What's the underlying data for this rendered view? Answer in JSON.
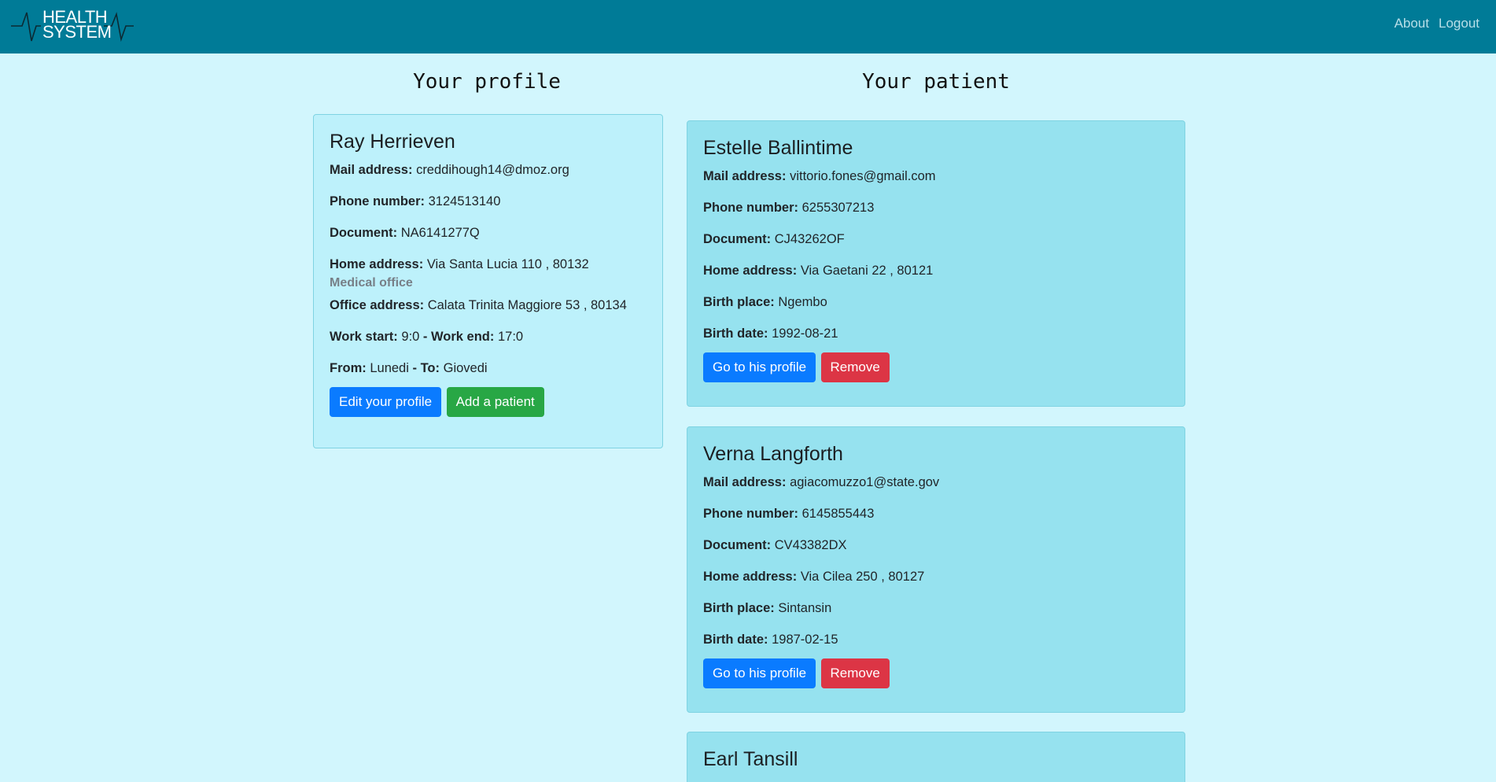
{
  "navbar": {
    "logo_line1": "HEALTH",
    "logo_line2": "SYSTEM",
    "about": "About",
    "logout": "Logout"
  },
  "profile": {
    "section_title": "Your profile",
    "name": "Ray Herrieven",
    "mail_label": "Mail address:",
    "mail": "creddihough14@dmoz.org",
    "phone_label": "Phone number:",
    "phone": "3124513140",
    "document_label": "Document:",
    "document": "NA6141277Q",
    "home_label": "Home address:",
    "home": "Via Santa Lucia 110 , 80132",
    "office_heading": "Medical office",
    "office_label": "Office address:",
    "office": "Calata Trinita Maggiore 53 , 80134",
    "work_start_label": "Work start:",
    "work_start": "9:0",
    "work_end_label": "Work end:",
    "work_end": "17:0",
    "from_label": "From:",
    "from": "Lunedi",
    "to_label": "To:",
    "to": "Giovedi",
    "dash": " - ",
    "edit_button": "Edit your profile",
    "add_button": "Add a patient"
  },
  "patients_section": {
    "section_title": "Your patient",
    "mail_label": "Mail address:",
    "phone_label": "Phone number:",
    "document_label": "Document:",
    "home_label": "Home address:",
    "birth_place_label": "Birth place:",
    "birth_date_label": "Birth date:",
    "go_button": "Go to his profile",
    "remove_button": "Remove"
  },
  "patients": [
    {
      "name": "Estelle Ballintime",
      "mail": "vittorio.fones@gmail.com",
      "phone": "6255307213",
      "document": "CJ43262OF",
      "home": "Via Gaetani 22 , 80121",
      "birth_place": "Ngembo",
      "birth_date": "1992-08-21"
    },
    {
      "name": "Verna Langforth",
      "mail": "agiacomuzzo1@state.gov",
      "phone": "6145855443",
      "document": "CV43382DX",
      "home": "Via Cilea 250 , 80127",
      "birth_place": "Sintansin",
      "birth_date": "1987-02-15"
    },
    {
      "name": "Earl Tansill"
    }
  ],
  "colors": {
    "navbar": "#007b97",
    "page_background": "#d2f6fd",
    "primary": "#0a7bff",
    "success": "#28a745",
    "danger": "#dc3545"
  }
}
